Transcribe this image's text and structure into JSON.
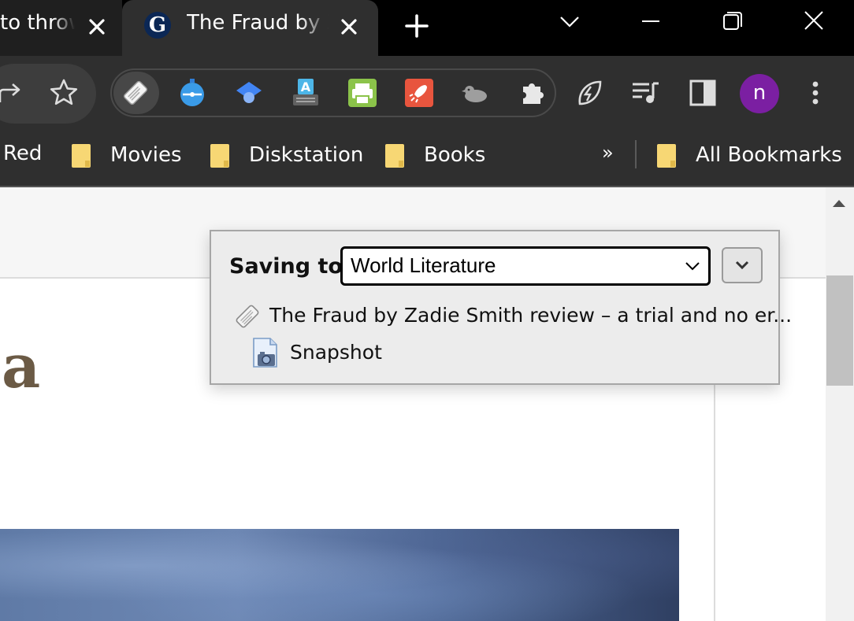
{
  "tabs": [
    {
      "title": "to throw",
      "active": false
    },
    {
      "title": "The Fraud by Z",
      "active": true,
      "favicon": "guardian-g-icon",
      "favicon_letter": "G"
    }
  ],
  "window_controls": [
    "tab-search-chevron-icon",
    "minimize-icon",
    "restore-icon",
    "close-icon"
  ],
  "toolbar": {
    "left_icons": [
      "share-icon",
      "bookmark-star-icon"
    ],
    "extensions": [
      "zotero-connector-icon",
      "timer-extension-icon",
      "scholar-extension-icon",
      "translate-extension-icon",
      "print-friendly-icon",
      "rocket-extension-icon",
      "bird-extension-icon",
      "extensions-puzzle-icon"
    ],
    "right_icons": [
      "leaf-performance-icon",
      "media-playlist-icon",
      "side-panel-icon"
    ],
    "profile_initial": "n",
    "profile_color": "#7b1fa2",
    "menu_icon": "kebab-menu-icon"
  },
  "bookmarks": {
    "items": [
      "Red",
      "Movies",
      "Diskstation",
      "Books"
    ],
    "overflow_label": "»",
    "all_bookmarks_label": "All Bookmarks",
    "folder_color": "#f7d774"
  },
  "page": {
    "headline_fragment": "a",
    "headline_color": "#6b5a45"
  },
  "zotero_popup": {
    "saving_to_label": "Saving to",
    "target_collection": "World Literature",
    "item_title": "The Fraud by Zadie Smith review – a trial and no er...",
    "attachment_label": "Snapshot"
  }
}
